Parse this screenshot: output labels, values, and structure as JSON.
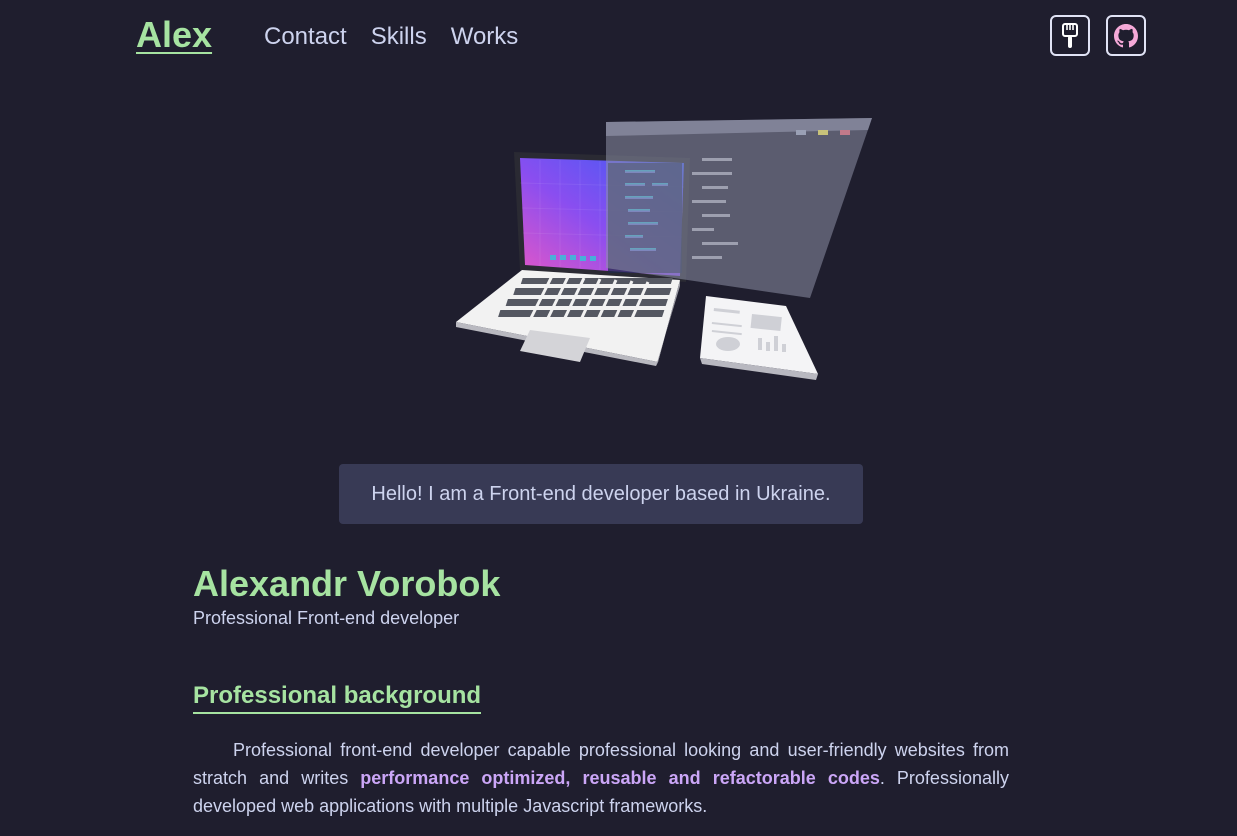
{
  "header": {
    "logo": "Alex",
    "nav": [
      "Contact",
      "Skills",
      "Works"
    ],
    "buttons": [
      {
        "icon": "paint-brush-icon"
      },
      {
        "icon": "github-icon"
      }
    ]
  },
  "greeting": "Hello! I am a Front-end developer based in Ukraine.",
  "profile": {
    "name": "Alexandr Vorobok",
    "role": "Professional Front-end developer"
  },
  "background": {
    "title": "Professional background",
    "text_before": "Professional front-end developer capable professional looking and user-friendly websites from stratch and writes ",
    "highlight": "performance optimized, reusable and refactorable codes",
    "text_after": ". Professionally developed web applications with multiple Javascript frameworks."
  },
  "colors": {
    "background": "#1f1e2e",
    "accent": "#a6e3a1",
    "highlight": "#cba6f7",
    "text": "#cdd3ee",
    "card": "#383a55"
  }
}
